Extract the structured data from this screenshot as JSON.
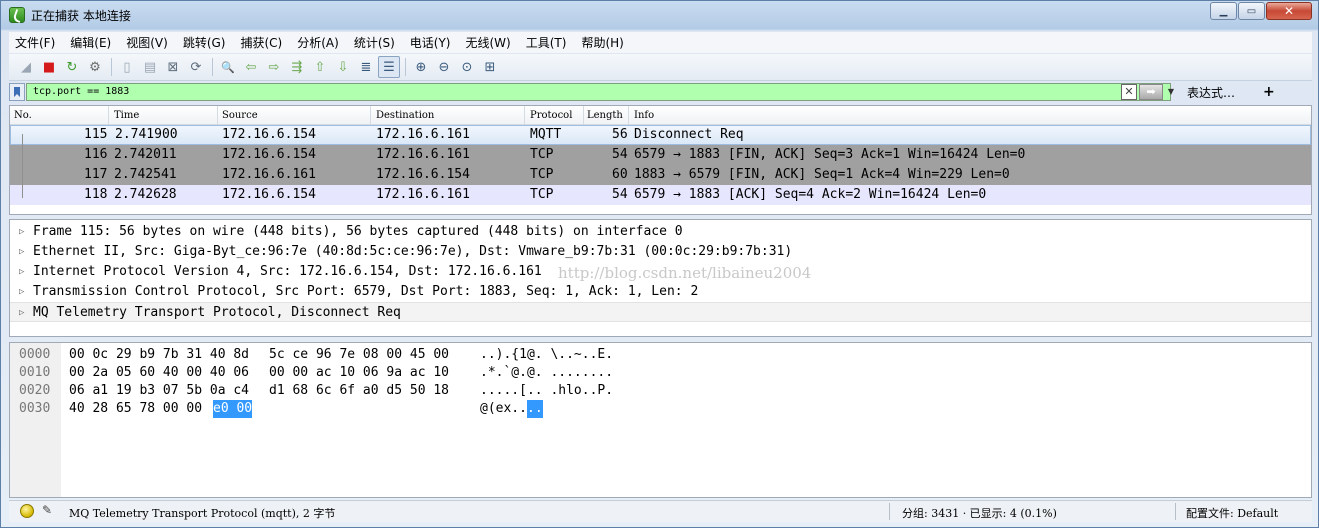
{
  "window": {
    "title": "正在捕获 本地连接",
    "controls": [
      "▁",
      "▭",
      "✕"
    ]
  },
  "menu": [
    "文件(F)",
    "编辑(E)",
    "视图(V)",
    "跳转(G)",
    "捕获(C)",
    "分析(A)",
    "统计(S)",
    "电话(Y)",
    "无线(W)",
    "工具(T)",
    "帮助(H)"
  ],
  "toolbar": {
    "icons": [
      "shark-fin-start-icon",
      "stop-icon",
      "restart-icon",
      "capture-options-icon",
      "open-file-icon",
      "save-file-icon",
      "close-file-icon",
      "reload-icon",
      "find-packet-icon",
      "go-back-icon",
      "go-forward-icon",
      "go-to-packet-icon",
      "go-first-icon",
      "go-last-icon",
      "autoscroll-icon",
      "colorize-icon",
      "zoom-in-icon",
      "zoom-out-icon",
      "zoom-normal-icon",
      "resize-columns-icon"
    ],
    "glyphs": [
      "◢",
      "■",
      "↻",
      "⚙",
      "▯",
      "▤",
      "⊠",
      "⟳",
      "🔍",
      "⇦",
      "⇨",
      "⇶",
      "⇧",
      "⇩",
      "≣",
      "☰",
      "⊕",
      "⊖",
      "⊙",
      "⊞"
    ]
  },
  "filter": {
    "value": "tcp.port == 1883",
    "clear": "✕",
    "apply": "➡",
    "dropdown": "▼",
    "expression_label": "表达式…",
    "add_label": "+"
  },
  "packet_list": {
    "columns": [
      "No.",
      "Time",
      "Source",
      "Destination",
      "Protocol",
      "Length",
      "Info"
    ],
    "rows": [
      {
        "no": "115",
        "time": "2.741900",
        "src": "172.16.6.154",
        "dst": "172.16.6.161",
        "proto": "MQTT",
        "len": "56",
        "info": "Disconnect Req"
      },
      {
        "no": "116",
        "time": "2.742011",
        "src": "172.16.6.154",
        "dst": "172.16.6.161",
        "proto": "TCP",
        "len": "54",
        "info": "6579 → 1883 [FIN, ACK] Seq=3 Ack=1 Win=16424 Len=0"
      },
      {
        "no": "117",
        "time": "2.742541",
        "src": "172.16.6.161",
        "dst": "172.16.6.154",
        "proto": "TCP",
        "len": "60",
        "info": "1883 → 6579 [FIN, ACK] Seq=1 Ack=4 Win=229 Len=0"
      },
      {
        "no": "118",
        "time": "2.742628",
        "src": "172.16.6.154",
        "dst": "172.16.6.161",
        "proto": "TCP",
        "len": "54",
        "info": "6579 → 1883 [ACK] Seq=4 Ack=2 Win=16424 Len=0"
      }
    ]
  },
  "details": [
    "Frame 115: 56 bytes on wire (448 bits), 56 bytes captured (448 bits) on interface 0",
    "Ethernet II, Src: Giga-Byt_ce:96:7e (40:8d:5c:ce:96:7e), Dst: Vmware_b9:7b:31 (00:0c:29:b9:7b:31)",
    "Internet Protocol Version 4, Src: 172.16.6.154, Dst: 172.16.6.161",
    "Transmission Control Protocol, Src Port: 6579, Dst Port: 1883, Seq: 1, Ack: 1, Len: 2",
    "MQ Telemetry Transport Protocol, Disconnect Req"
  ],
  "watermark": "http://blog.csdn.net/libaineu2004",
  "bytes": [
    {
      "offset": "0000",
      "hex1": "00 0c 29 b9 7b 31 40 8d",
      "hex2": "5c ce 96 7e 08 00 45 00",
      "ascii": "..).{1@. \\..~..E."
    },
    {
      "offset": "0010",
      "hex1": "00 2a 05 60 40 00 40 06",
      "hex2": "00 00 ac 10 06 9a ac 10",
      "ascii": ".*.`@.@. ........"
    },
    {
      "offset": "0020",
      "hex1": "06 a1 19 b3 07 5b 0a c4",
      "hex2": "d1 68 6c 6f a0 d5 50 18",
      "ascii": ".....[.. .hlo..P."
    },
    {
      "offset": "0030",
      "hex1": "40 28 65 78 00 00",
      "hex_sel": "e0 00",
      "ascii": "@(ex..",
      "ascii_sel": ".."
    }
  ],
  "status": {
    "field": "MQ Telemetry Transport Protocol (mqtt), 2 字节",
    "packets": "分组: 3431 · 已显示: 4 (0.1%)",
    "profile": "配置文件: Default"
  }
}
